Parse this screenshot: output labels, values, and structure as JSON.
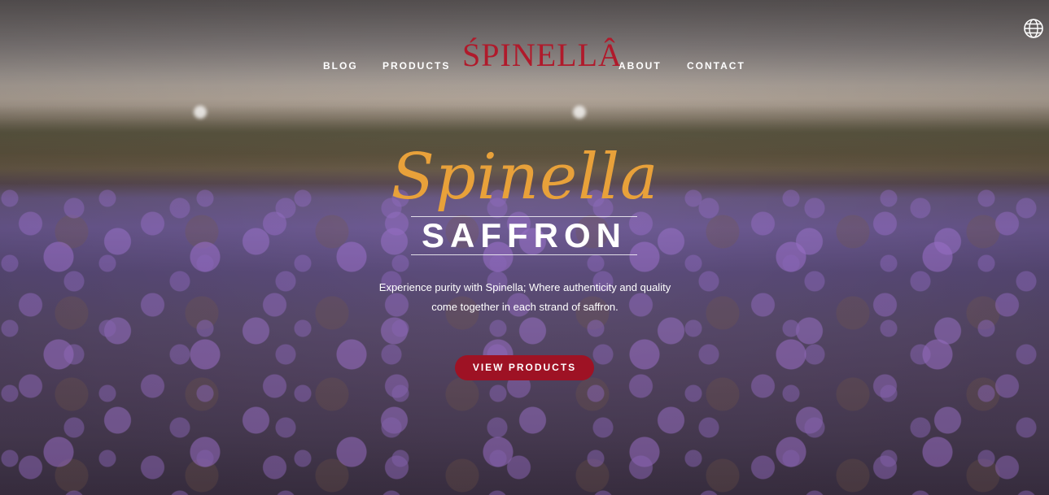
{
  "nav": {
    "left_links": [
      "BLOG",
      "PRODUCTS"
    ],
    "logo_text": "ŚPINELLÂ",
    "right_links": [
      "ABOUT",
      "CONTACT"
    ],
    "language_icon": "globe-icon"
  },
  "hero": {
    "script_title": "Spinella",
    "title": "SAFFRON",
    "tagline_line1": "Experience purity with Spinella; Where authenticity and quality",
    "tagline_line2": "come together in each strand of saffron.",
    "cta_label": "VIEW PRODUCTS"
  },
  "colors": {
    "logo": "#b01a2b",
    "script": "#e8a13a",
    "cta_background": "#9e1224",
    "text": "#ffffff"
  }
}
